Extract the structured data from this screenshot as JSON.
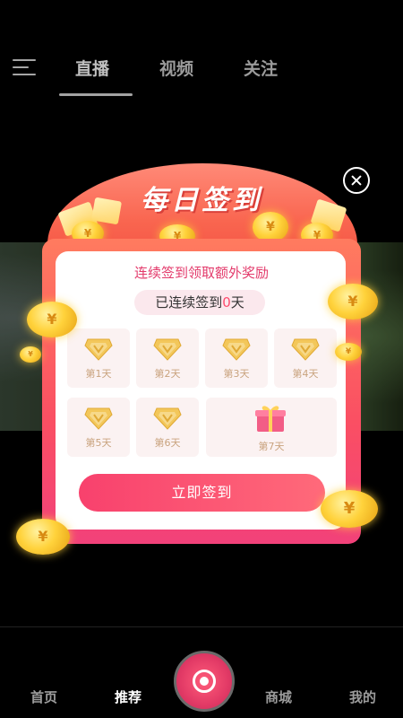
{
  "top_nav": {
    "tabs": [
      {
        "label": "直播",
        "active": true
      },
      {
        "label": "视频",
        "active": false
      },
      {
        "label": "关注",
        "active": false
      }
    ]
  },
  "popup": {
    "title": "每日签到",
    "subtitle": "连续签到领取额外奖励",
    "status_prefix": "已连续签到",
    "status_count": "0",
    "status_suffix": "天",
    "days": [
      {
        "label": "第1天",
        "icon": "diamond-icon"
      },
      {
        "label": "第2天",
        "icon": "diamond-icon"
      },
      {
        "label": "第3天",
        "icon": "diamond-icon"
      },
      {
        "label": "第4天",
        "icon": "diamond-icon"
      },
      {
        "label": "第5天",
        "icon": "diamond-icon"
      },
      {
        "label": "第6天",
        "icon": "diamond-icon"
      },
      {
        "label": "第7天",
        "icon": "gift-box-icon"
      }
    ],
    "button_label": "立即签到"
  },
  "bottom_nav": {
    "items": [
      {
        "label": "首页",
        "active": false
      },
      {
        "label": "推荐",
        "active": true
      },
      {
        "label": "商城",
        "active": false
      },
      {
        "label": "我的",
        "active": false
      }
    ],
    "center_icon": "camera-icon"
  },
  "colors": {
    "accent": "#f8416d",
    "card_gradient_top": "#ff7b5f",
    "card_gradient_bottom": "#f2417a",
    "gem_gold": "#f3c75a",
    "day_label": "#c9a37e"
  }
}
